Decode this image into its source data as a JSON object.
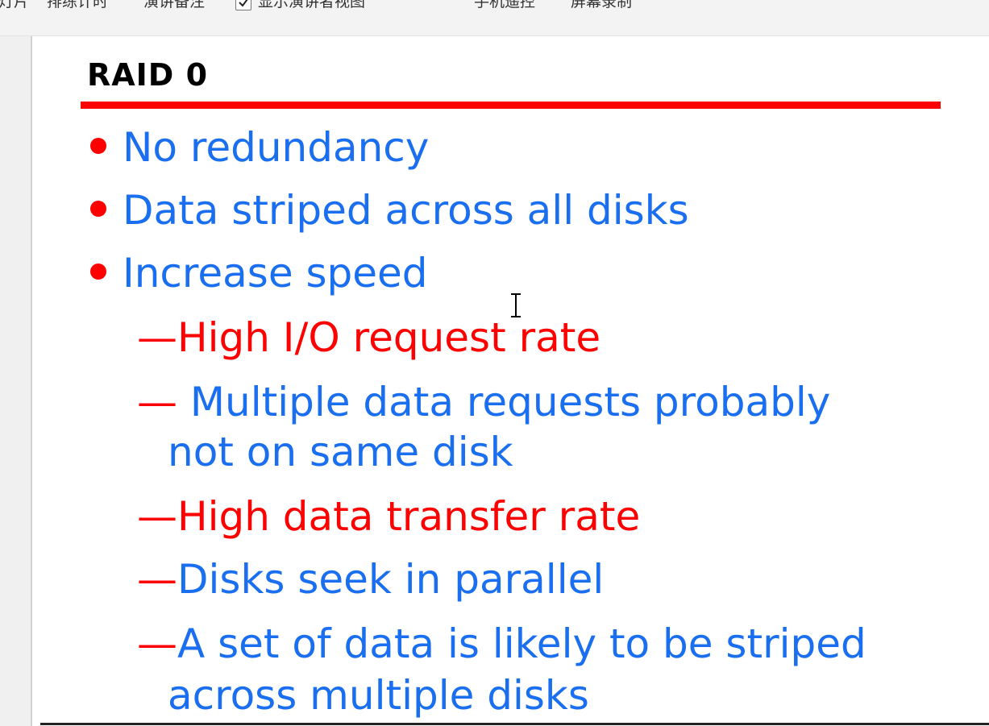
{
  "toolbar": {
    "items": [
      "灯片",
      "排练计时",
      "演讲备注",
      "显示演讲者视图",
      "手机遥控",
      "屏幕录制"
    ],
    "presenter_view_checked": true
  },
  "slide": {
    "title": "RAID 0",
    "bullets": [
      "No redundancy",
      "Data striped across all disks",
      "Increase speed"
    ],
    "sub_items": [
      {
        "dash": "—",
        "text": "High I/O request rate",
        "color": "red"
      },
      {
        "dash": "—",
        "text": " Multiple data requests probably",
        "cont": "not on same disk",
        "color": "blue"
      },
      {
        "dash": "—",
        "text": "High data transfer rate",
        "color": "red"
      },
      {
        "dash": "—",
        "text": "Disks seek in parallel",
        "color": "blue"
      },
      {
        "dash": "—",
        "text": "A set of data is likely to be striped",
        "cont": "across multiple disks",
        "color": "blue"
      }
    ]
  },
  "colors": {
    "title_rule": "#ff0000",
    "bullet_text": "#1a6ef0",
    "accent_red": "#ff0000"
  },
  "icons": {
    "text_cursor": "i-beam-cursor-icon",
    "check": "checkmark-icon"
  }
}
